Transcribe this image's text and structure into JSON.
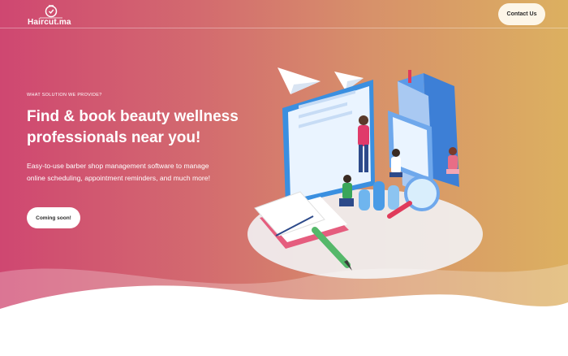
{
  "header": {
    "logo_text": "Haircut.ma",
    "contact_label": "Contact Us"
  },
  "hero": {
    "eyebrow": "WHAT SOLUTION WE PROVIDE?",
    "headline_line1": "Find & book beauty wellness",
    "headline_line2": "professionals near you!",
    "subtext_line1": "Easy-to-use barber shop management software to manage",
    "subtext_line2": "online scheduling, appointment reminders, and much more!",
    "cta_label": "Coming soon!"
  },
  "colors": {
    "gradient_start": "#cf4771",
    "gradient_end": "#dcb060",
    "button_bg": "#fdf6e8",
    "text": "#ffffff"
  },
  "icons": {
    "logo": "clock-icon"
  }
}
